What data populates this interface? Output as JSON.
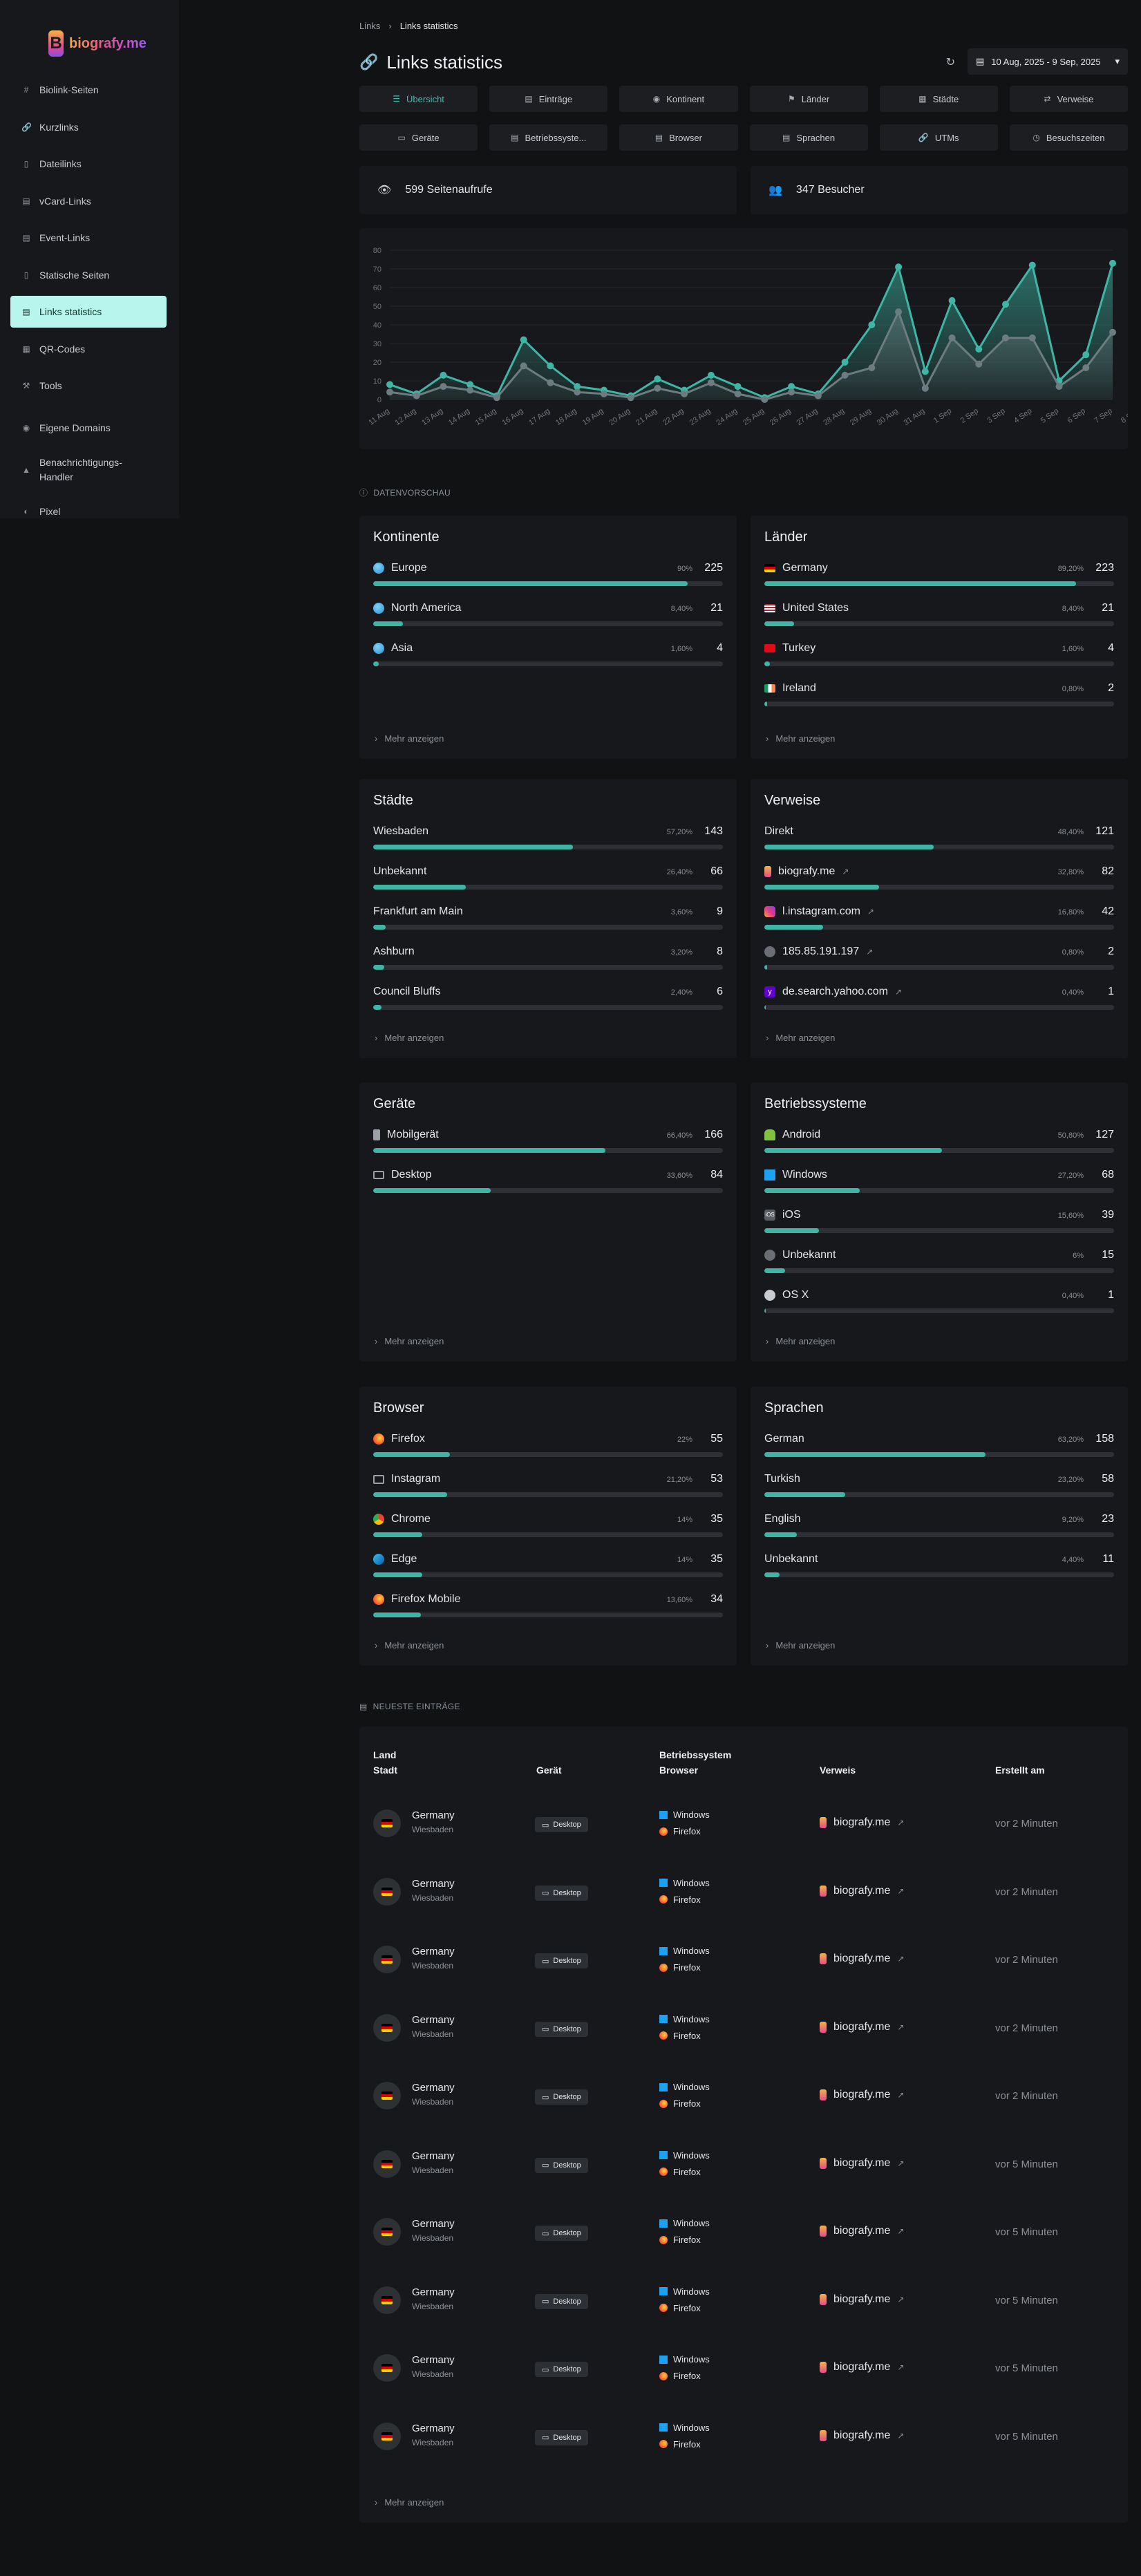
{
  "sidebar": {
    "logo_text": "biografy.me",
    "items": [
      {
        "label": "Biolink-Seiten",
        "icon": "hash-icon"
      },
      {
        "label": "Kurzlinks",
        "icon": "link-icon"
      },
      {
        "label": "Dateilinks",
        "icon": "file-icon"
      },
      {
        "label": "vCard-Links",
        "icon": "id-card-icon"
      },
      {
        "label": "Event-Links",
        "icon": "calendar-icon"
      },
      {
        "label": "Statische Seiten",
        "icon": "file-code-icon"
      },
      {
        "label": "Links statistics",
        "icon": "chart-icon",
        "active": true
      },
      {
        "label": "QR-Codes",
        "icon": "qrcode-icon"
      },
      {
        "label": "Tools",
        "icon": "tools-icon"
      },
      {
        "label": "Eigene Domains",
        "icon": "globe-icon"
      },
      {
        "label": "Benachrichtigungs-Handler",
        "icon": "bell-icon"
      },
      {
        "label": "Pixel",
        "icon": "pixel-icon"
      }
    ]
  },
  "breadcrumb": {
    "parent": "Links",
    "current": "Links statistics"
  },
  "header": {
    "title": "Links statistics",
    "date_range": "10 Aug, 2025 - 9 Sep, 2025"
  },
  "tabs": [
    "Übersicht",
    "Einträge",
    "Kontinent",
    "Länder",
    "Städte",
    "Verweise",
    "Geräte",
    "Betriebssyste...",
    "Browser",
    "Sprachen",
    "UTMs",
    "Besuchszeiten"
  ],
  "stats": {
    "pageviews": "599 Seitenaufrufe",
    "visitors": "347 Besucher"
  },
  "chart_data": {
    "type": "area",
    "x": [
      "11 Aug",
      "12 Aug",
      "13 Aug",
      "14 Aug",
      "15 Aug",
      "16 Aug",
      "17 Aug",
      "18 Aug",
      "19 Aug",
      "20 Aug",
      "21 Aug",
      "22 Aug",
      "23 Aug",
      "24 Aug",
      "25 Aug",
      "26 Aug",
      "27 Aug",
      "28 Aug",
      "29 Aug",
      "30 Aug",
      "31 Aug",
      "1 Sep",
      "2 Sep",
      "3 Sep",
      "4 Sep",
      "5 Sep",
      "6 Sep",
      "7 Sep",
      "8 Sep",
      "9 Sep"
    ],
    "series": [
      {
        "values": [
          8,
          3,
          13,
          8,
          2,
          32,
          18,
          7,
          5,
          2,
          11,
          5,
          13,
          7,
          1,
          7,
          3,
          20,
          40,
          71,
          15,
          53,
          27,
          51,
          72,
          10,
          24,
          73
        ]
      },
      {
        "values": [
          4,
          2,
          7,
          5,
          1,
          18,
          9,
          4,
          3,
          1,
          6,
          3,
          9,
          3,
          0,
          4,
          2,
          13,
          17,
          47,
          6,
          33,
          19,
          33,
          33,
          7,
          17,
          36
        ]
      }
    ],
    "ylim": [
      0,
      80
    ],
    "yticks": [
      0,
      10,
      20,
      30,
      40,
      50,
      60,
      70,
      80
    ],
    "colors": [
      "#3fb5a6",
      "#6c7c80"
    ]
  },
  "sections": {
    "preview": "DATENVORSCHAU",
    "latest": "NEUESTE EINTRÄGE"
  },
  "more_label": "Mehr anzeigen",
  "cards": [
    {
      "title": "Kontinente",
      "rows": [
        {
          "label": "Europe",
          "pct": "90%",
          "count": "225",
          "fill": 90,
          "icon": "globe"
        },
        {
          "label": "North America",
          "pct": "8,40%",
          "count": "21",
          "fill": 8.4,
          "icon": "globe"
        },
        {
          "label": "Asia",
          "pct": "1,60%",
          "count": "4",
          "fill": 1.6,
          "icon": "globe"
        }
      ]
    },
    {
      "title": "Länder",
      "rows": [
        {
          "label": "Germany",
          "pct": "89,20%",
          "count": "223",
          "fill": 89.2,
          "icon": "de"
        },
        {
          "label": "United States",
          "pct": "8,40%",
          "count": "21",
          "fill": 8.4,
          "icon": "us"
        },
        {
          "label": "Turkey",
          "pct": "1,60%",
          "count": "4",
          "fill": 1.6,
          "icon": "tr"
        },
        {
          "label": "Ireland",
          "pct": "0,80%",
          "count": "2",
          "fill": 0.8,
          "icon": "ie"
        }
      ]
    },
    {
      "title": "Städte",
      "rows": [
        {
          "label": "Wiesbaden",
          "pct": "57,20%",
          "count": "143",
          "fill": 57.2
        },
        {
          "label": "Unbekannt",
          "pct": "26,40%",
          "count": "66",
          "fill": 26.4
        },
        {
          "label": "Frankfurt am Main",
          "pct": "3,60%",
          "count": "9",
          "fill": 3.6
        },
        {
          "label": "Ashburn",
          "pct": "3,20%",
          "count": "8",
          "fill": 3.2
        },
        {
          "label": "Council Bluffs",
          "pct": "2,40%",
          "count": "6",
          "fill": 2.4
        }
      ]
    },
    {
      "title": "Verweise",
      "rows": [
        {
          "label": "Direkt",
          "pct": "48,40%",
          "count": "121",
          "fill": 48.4
        },
        {
          "label": "biografy.me",
          "pct": "32,80%",
          "count": "82",
          "fill": 32.8,
          "icon": "biografy",
          "ext": true
        },
        {
          "label": "l.instagram.com",
          "pct": "16,80%",
          "count": "42",
          "fill": 16.8,
          "icon": "instagram",
          "ext": true
        },
        {
          "label": "185.85.191.197",
          "pct": "0,80%",
          "count": "2",
          "fill": 0.8,
          "icon": "ip",
          "ext": true
        },
        {
          "label": "de.search.yahoo.com",
          "pct": "0,40%",
          "count": "1",
          "fill": 0.4,
          "icon": "yahoo",
          "ext": true
        }
      ]
    },
    {
      "title": "Geräte",
      "rows": [
        {
          "label": "Mobilgerät",
          "pct": "66,40%",
          "count": "166",
          "fill": 66.4,
          "icon": "mobile"
        },
        {
          "label": "Desktop",
          "pct": "33,60%",
          "count": "84",
          "fill": 33.6,
          "icon": "desktop"
        }
      ]
    },
    {
      "title": "Betriebssysteme",
      "rows": [
        {
          "label": "Android",
          "pct": "50,80%",
          "count": "127",
          "fill": 50.8,
          "icon": "android"
        },
        {
          "label": "Windows",
          "pct": "27,20%",
          "count": "68",
          "fill": 27.2,
          "icon": "windows"
        },
        {
          "label": "iOS",
          "pct": "15,60%",
          "count": "39",
          "fill": 15.6,
          "icon": "ios"
        },
        {
          "label": "Unbekannt",
          "pct": "6%",
          "count": "15",
          "fill": 6,
          "icon": "unknown"
        },
        {
          "label": "OS X",
          "pct": "0,40%",
          "count": "1",
          "fill": 0.4,
          "icon": "apple"
        }
      ]
    },
    {
      "title": "Browser",
      "rows": [
        {
          "label": "Firefox",
          "pct": "22%",
          "count": "55",
          "fill": 22,
          "icon": "firefox"
        },
        {
          "label": "Instagram",
          "pct": "21,20%",
          "count": "53",
          "fill": 21.2,
          "icon": "window"
        },
        {
          "label": "Chrome",
          "pct": "14%",
          "count": "35",
          "fill": 14,
          "icon": "chrome"
        },
        {
          "label": "Edge",
          "pct": "14%",
          "count": "35",
          "fill": 14,
          "icon": "edge"
        },
        {
          "label": "Firefox Mobile",
          "pct": "13,60%",
          "count": "34",
          "fill": 13.6,
          "icon": "firefox"
        }
      ]
    },
    {
      "title": "Sprachen",
      "rows": [
        {
          "label": "German",
          "pct": "63,20%",
          "count": "158",
          "fill": 63.2
        },
        {
          "label": "Turkish",
          "pct": "23,20%",
          "count": "58",
          "fill": 23.2
        },
        {
          "label": "English",
          "pct": "9,20%",
          "count": "23",
          "fill": 9.2
        },
        {
          "label": "Unbekannt",
          "pct": "4,40%",
          "count": "11",
          "fill": 4.4
        }
      ]
    }
  ],
  "table": {
    "headers": {
      "land": "Land",
      "stadt": "Stadt",
      "geraet": "Gerät",
      "os": "Betriebssystem",
      "browser": "Browser",
      "verweis": "Verweis",
      "erstellt": "Erstellt am"
    },
    "rows": [
      {
        "country": "Germany",
        "city": "Wiesbaden",
        "device": "Desktop",
        "os": "Windows",
        "browser": "Firefox",
        "referrer": "biografy.me",
        "time": "vor 2 Minuten"
      },
      {
        "country": "Germany",
        "city": "Wiesbaden",
        "device": "Desktop",
        "os": "Windows",
        "browser": "Firefox",
        "referrer": "biografy.me",
        "time": "vor 2 Minuten"
      },
      {
        "country": "Germany",
        "city": "Wiesbaden",
        "device": "Desktop",
        "os": "Windows",
        "browser": "Firefox",
        "referrer": "biografy.me",
        "time": "vor 2 Minuten"
      },
      {
        "country": "Germany",
        "city": "Wiesbaden",
        "device": "Desktop",
        "os": "Windows",
        "browser": "Firefox",
        "referrer": "biografy.me",
        "time": "vor 2 Minuten"
      },
      {
        "country": "Germany",
        "city": "Wiesbaden",
        "device": "Desktop",
        "os": "Windows",
        "browser": "Firefox",
        "referrer": "biografy.me",
        "time": "vor 2 Minuten"
      },
      {
        "country": "Germany",
        "city": "Wiesbaden",
        "device": "Desktop",
        "os": "Windows",
        "browser": "Firefox",
        "referrer": "biografy.me",
        "time": "vor 5 Minuten"
      },
      {
        "country": "Germany",
        "city": "Wiesbaden",
        "device": "Desktop",
        "os": "Windows",
        "browser": "Firefox",
        "referrer": "biografy.me",
        "time": "vor 5 Minuten"
      },
      {
        "country": "Germany",
        "city": "Wiesbaden",
        "device": "Desktop",
        "os": "Windows",
        "browser": "Firefox",
        "referrer": "biografy.me",
        "time": "vor 5 Minuten"
      },
      {
        "country": "Germany",
        "city": "Wiesbaden",
        "device": "Desktop",
        "os": "Windows",
        "browser": "Firefox",
        "referrer": "biografy.me",
        "time": "vor 5 Minuten"
      },
      {
        "country": "Germany",
        "city": "Wiesbaden",
        "device": "Desktop",
        "os": "Windows",
        "browser": "Firefox",
        "referrer": "biografy.me",
        "time": "vor 5 Minuten"
      }
    ]
  }
}
